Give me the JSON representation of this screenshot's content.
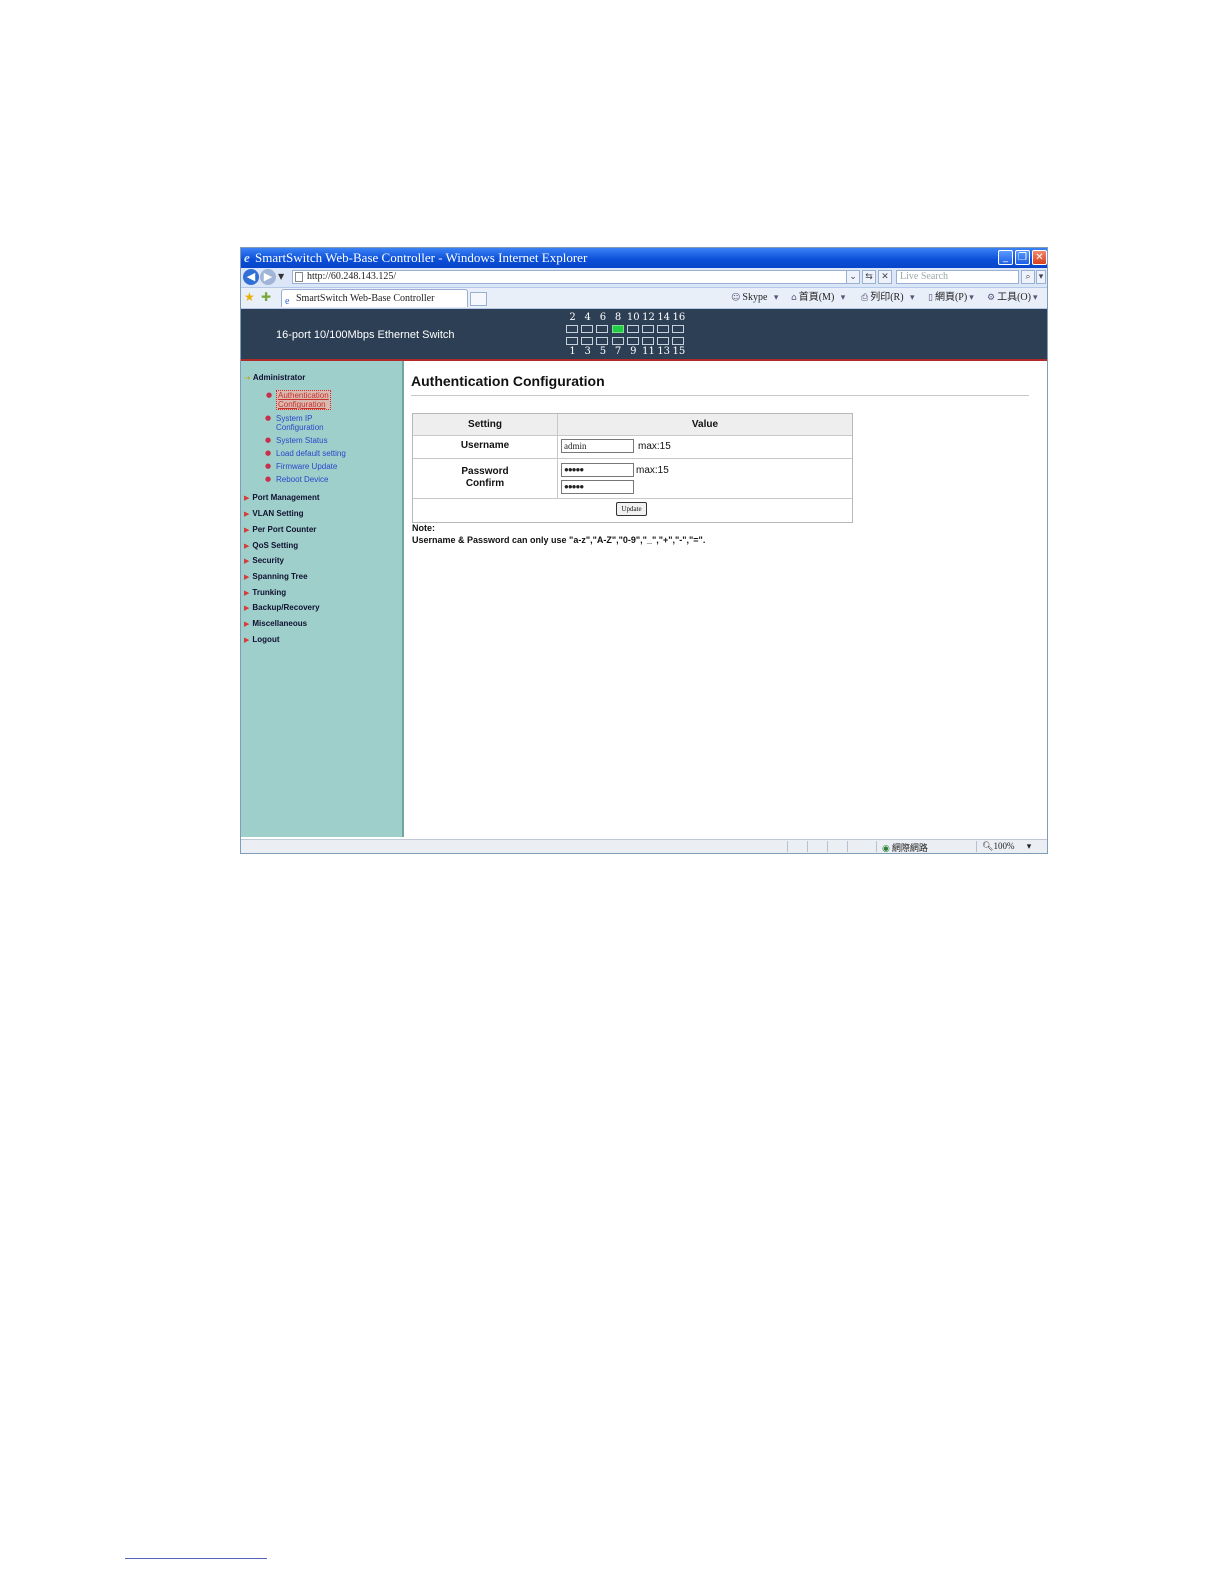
{
  "window": {
    "title": "SmartSwitch Web-Base Controller - Windows Internet Explorer",
    "minimize_glyph": "_",
    "restore_glyph": "❐",
    "close_glyph": "✕"
  },
  "address_bar": {
    "url": "http://60.248.143.125/",
    "search_placeholder": "Live Search",
    "back_glyph": "◀",
    "forward_glyph": "▶"
  },
  "tab": {
    "label": "SmartSwitch Web-Base Controller"
  },
  "command_bar": {
    "skype": "Skype",
    "home": "首頁(M)",
    "print": "列印(R)",
    "page": "網頁(P)",
    "tools": "工具(O)"
  },
  "header": {
    "device_name": "16-port 10/100Mbps Ethernet Switch",
    "top_ports": [
      "2",
      "4",
      "6",
      "8",
      "10",
      "12",
      "14",
      "16"
    ],
    "bottom_ports": [
      "1",
      "3",
      "5",
      "7",
      "9",
      "11",
      "13",
      "15"
    ],
    "active_port": "8",
    "active_color": "#22cc44"
  },
  "sidebar": {
    "administrator": "Administrator",
    "sub_items": [
      {
        "line1": "Authentication",
        "line2": "Configuration"
      },
      {
        "line1": "System IP",
        "line2": "Configuration"
      },
      {
        "line1": "System Status"
      },
      {
        "line1": "Load default setting"
      },
      {
        "line1": "Firmware Update"
      },
      {
        "line1": "Reboot Device"
      }
    ],
    "menus": [
      "Port Management",
      "VLAN Setting",
      "Per Port Counter",
      "QoS Setting",
      "Security",
      "Spanning Tree",
      "Trunking",
      "Backup/Recovery",
      "Miscellaneous",
      "Logout"
    ]
  },
  "content": {
    "title": "Authentication Configuration",
    "col_setting": "Setting",
    "col_value": "Value",
    "username_label": "Username",
    "username_value": "admin",
    "username_max": "max:15",
    "password_label": "Password",
    "confirm_label": "Confirm",
    "password_value": "●●●●●",
    "confirm_value": "●●●●●",
    "password_max": "max:15",
    "update_button": "Update",
    "note_label": "Note:",
    "note_text": "Username & Password can only use \"a-z\",\"A-Z\",\"0-9\",\"_\",\"+\",\"-\",\"=\"."
  },
  "status_bar": {
    "zone": "網際網路",
    "zoom": "100%"
  }
}
